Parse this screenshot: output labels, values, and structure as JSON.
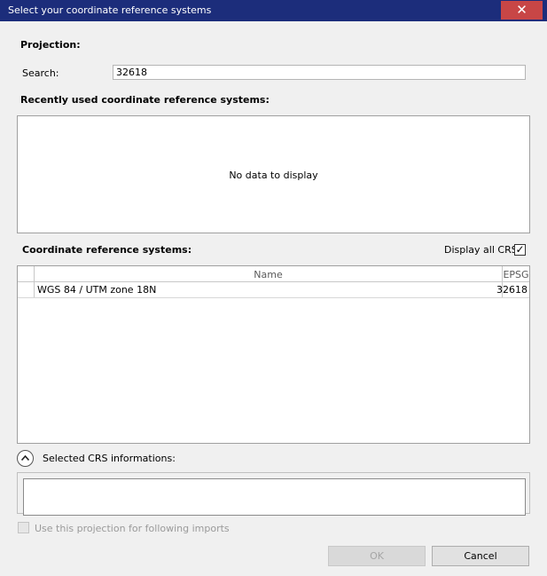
{
  "window": {
    "title": "Select your coordinate reference systems",
    "close_glyph": "✕"
  },
  "projection": {
    "heading": "Projection:",
    "search_label": "Search:",
    "search_value": "32618"
  },
  "recent": {
    "heading": "Recently used coordinate reference systems:",
    "empty_message": "No data to display"
  },
  "crs": {
    "heading": "Coordinate reference systems:",
    "display_all_label": "Display all CRS",
    "display_all_checked": true,
    "check_glyph": "✓",
    "columns": {
      "name": "Name",
      "epsg": "EPSG"
    },
    "rows": [
      {
        "name": "WGS 84 / UTM zone 18N",
        "epsg": "32618"
      }
    ]
  },
  "selected_info": {
    "label": "Selected CRS informations:",
    "expander_icon": "chevron-up-icon"
  },
  "use_projection": {
    "label": "Use this projection for following imports",
    "checked": false
  },
  "buttons": {
    "ok": "OK",
    "cancel": "Cancel"
  }
}
